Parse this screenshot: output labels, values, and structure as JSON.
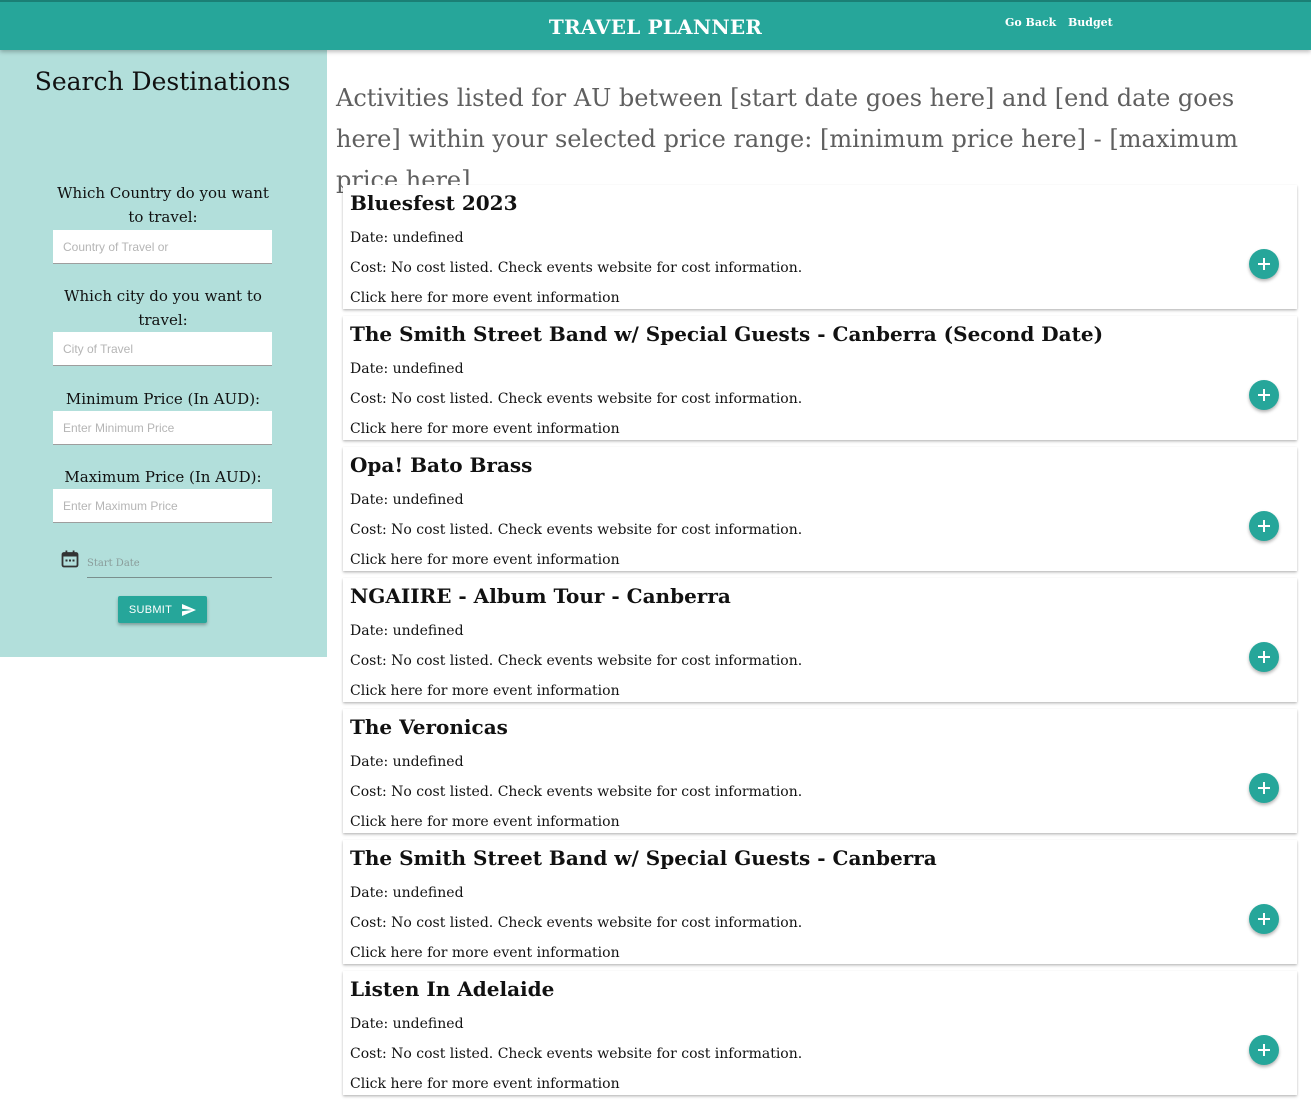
{
  "header": {
    "title": "TRAVEL PLANNER",
    "nav": [
      {
        "label": "Go Back"
      },
      {
        "label": "Budget"
      }
    ]
  },
  "sidebar": {
    "title": "Search Destinations",
    "country_label": "Which Country do you want to travel:",
    "country_placeholder": "Country of Travel or",
    "city_label": "Which city do you want to travel:",
    "city_placeholder": "City of Travel",
    "min_label": "Minimum Price (In AUD):",
    "min_placeholder": "Enter Minimum Price",
    "max_label": "Maximum Price (In AUD):",
    "max_placeholder": "Enter Maximum Price",
    "date_placeholder": "Start Date",
    "submit_label": "SUBMIT"
  },
  "main": {
    "heading": "Activities listed for AU between [start date goes here] and [end date goes here] within your selected price range: [minimum price here] - [maximum price here]"
  },
  "events": [
    {
      "title": "Bluesfest 2023",
      "date": "Date: undefined",
      "cost": "Cost: No cost listed. Check events website for cost information.",
      "link": "Click here for more event information"
    },
    {
      "title": "The Smith Street Band w/ Special Guests - Canberra (Second Date)",
      "date": "Date: undefined",
      "cost": "Cost: No cost listed. Check events website for cost information.",
      "link": "Click here for more event information"
    },
    {
      "title": "Opa! Bato Brass",
      "date": "Date: undefined",
      "cost": "Cost: No cost listed. Check events website for cost information.",
      "link": "Click here for more event information"
    },
    {
      "title": "NGAIIRE - Album Tour - Canberra",
      "date": "Date: undefined",
      "cost": "Cost: No cost listed. Check events website for cost information.",
      "link": "Click here for more event information"
    },
    {
      "title": "The Veronicas",
      "date": "Date: undefined",
      "cost": "Cost: No cost listed. Check events website for cost information.",
      "link": "Click here for more event information"
    },
    {
      "title": "The Smith Street Band w/ Special Guests - Canberra",
      "date": "Date: undefined",
      "cost": "Cost: No cost listed. Check events website for cost information.",
      "link": "Click here for more event information"
    },
    {
      "title": "Listen In Adelaide",
      "date": "Date: undefined",
      "cost": "Cost: No cost listed. Check events website for cost information.",
      "link": "Click here for more event information"
    }
  ],
  "icons": {
    "date": "calendar-icon",
    "submit": "send-icon",
    "add": "add-icon"
  },
  "colors": {
    "primary": "#26a69a",
    "sidebar_bg": "#b2dfdb",
    "heading_text": "#5f5f5f"
  }
}
